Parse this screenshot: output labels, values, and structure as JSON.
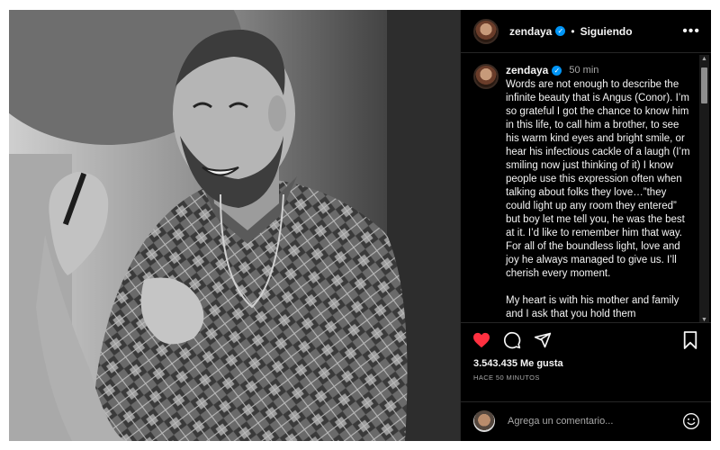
{
  "post": {
    "username": "zendaya",
    "verified_glyph": "✓",
    "separator": "•",
    "follow_status": "Siguiendo",
    "more_label": "•••",
    "caption": {
      "username": "zendaya",
      "time": "50 min",
      "paragraphs": [
        "Words are not enough to describe the infinite beauty that is Angus (Conor). I’m so grateful I got the chance to know him in this life, to call him a brother, to see his warm kind eyes and bright smile, or hear his infectious cackle of a laugh (I’m smiling now just thinking of it) I know people use this expression often when talking about folks they love…”they could light up any room they entered” but boy let me tell you, he was the best at it. I’d like to remember him that way. For all of the boundless light, love and joy he always managed to give us. I’ll cherish every moment.",
        "My heart is with his mother and family and I ask that you hold them"
      ]
    },
    "likes": "3.543.435 Me gusta",
    "posted_ago": "HACE 50 MINUTOS",
    "comment_placeholder": "Agrega un comentario...",
    "colors": {
      "like_red": "#ff3040",
      "verified_blue": "#0095f6"
    },
    "icons": [
      "heart-icon",
      "comment-icon",
      "share-icon",
      "bookmark-icon",
      "emoji-icon",
      "more-icon",
      "verified-icon"
    ]
  }
}
